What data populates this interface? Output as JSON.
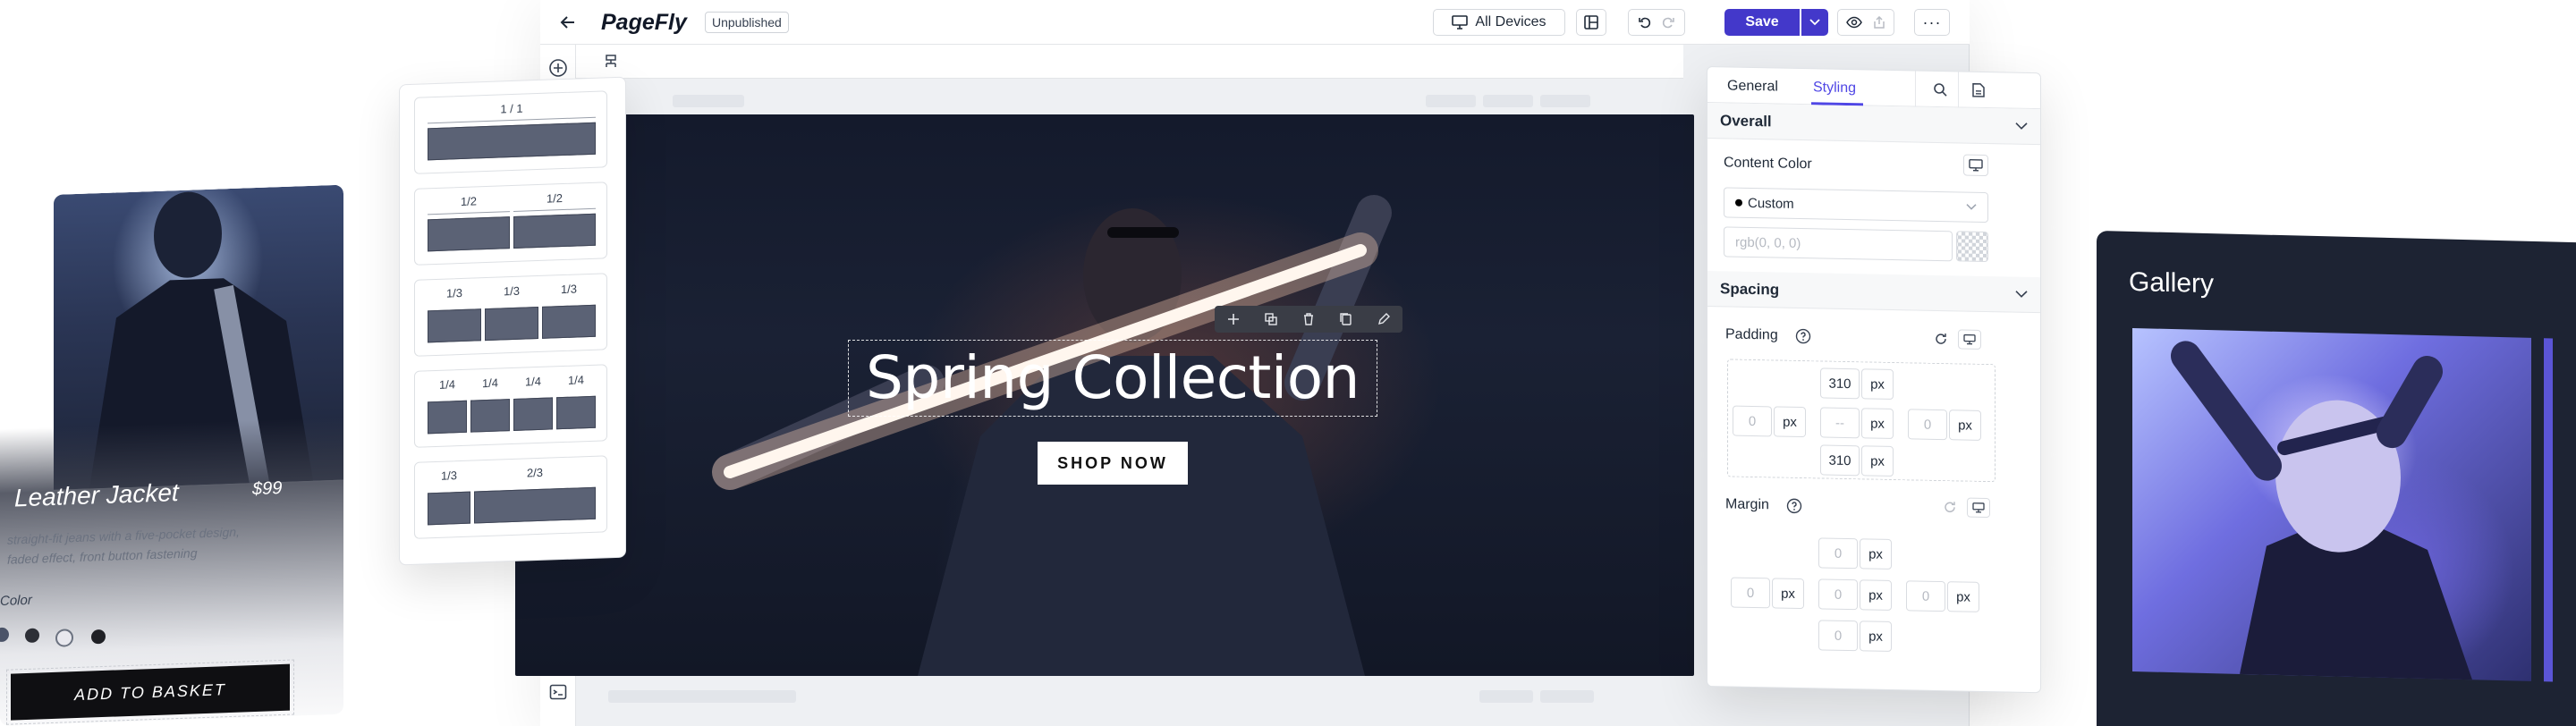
{
  "app": {
    "name": "PageFly",
    "status_badge": "Unpublished"
  },
  "toolbar": {
    "devices_label": "All Devices",
    "save_label": "Save"
  },
  "layouts": [
    {
      "labels": [
        "1 / 1"
      ]
    },
    {
      "labels": [
        "1/2",
        "1/2"
      ]
    },
    {
      "labels": [
        "1/3",
        "1/3",
        "1/3"
      ]
    },
    {
      "labels": [
        "1/4",
        "1/4",
        "1/4",
        "1/4"
      ]
    },
    {
      "labels": [
        "1/3",
        "2/3"
      ]
    }
  ],
  "hero": {
    "title": "Spring Collection",
    "cta": "SHOP NOW"
  },
  "product": {
    "name": "Leather Jacket",
    "price": "$99",
    "description_line1": "straight-fit jeans with a five-pocket design,",
    "description_line2": "faded effect, front button fastening",
    "color_label": "Color",
    "swatches": [
      "#4b5368",
      "#2d2f36",
      "#e8e8ee",
      "#1f2025"
    ],
    "add_to_basket": "ADD TO BASKET"
  },
  "panel": {
    "tabs": [
      "General",
      "Styling"
    ],
    "active_tab": "Styling",
    "overall": {
      "title": "Overall",
      "content_color_label": "Content Color",
      "color_mode": "Custom",
      "color_value_placeholder": "rgb(0, 0, 0)"
    },
    "spacing": {
      "title": "Spacing",
      "padding_label": "Padding",
      "padding": {
        "top": "310",
        "right": "0",
        "bottom": "310",
        "left": "0",
        "center": "--"
      },
      "margin_label": "Margin",
      "margin": {
        "top": "0",
        "right": "0",
        "bottom": "0",
        "left": "0",
        "center": "0"
      },
      "unit": "px"
    }
  },
  "gallery": {
    "title": "Gallery"
  },
  "colors": {
    "accent": "#4f46e5",
    "save": "#4338ca"
  }
}
